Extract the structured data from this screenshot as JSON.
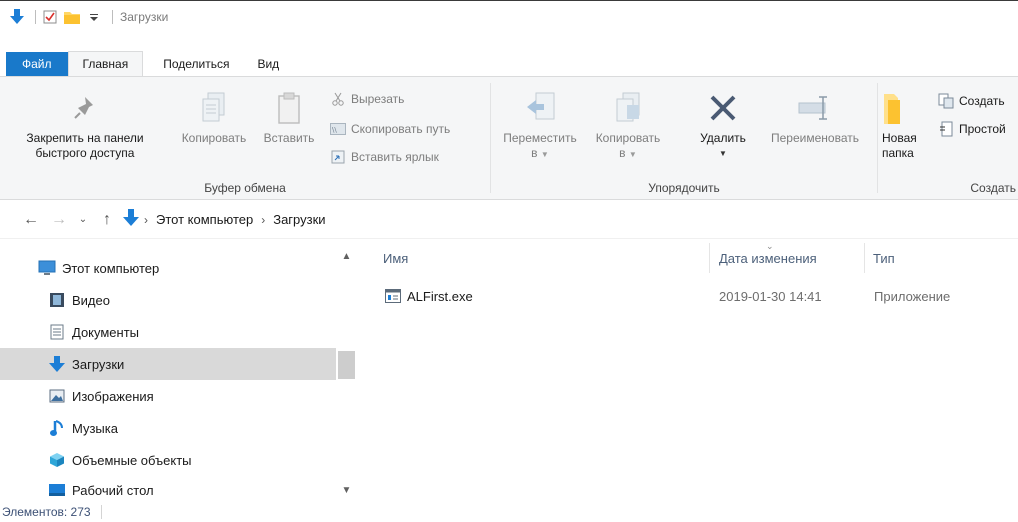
{
  "window": {
    "title": "Загрузки"
  },
  "quick_access": {
    "icons": [
      "download-arrow-icon",
      "properties-icon",
      "new-folder-icon",
      "customize-dropdown-icon"
    ]
  },
  "ribbon_tabs": [
    "Файл",
    "Главная",
    "Поделиться",
    "Вид"
  ],
  "ribbon": {
    "clipboard": {
      "group_label": "Буфер обмена",
      "pin_line1": "Закрепить на панели",
      "pin_line2": "быстрого доступа",
      "copy": "Копировать",
      "paste": "Вставить",
      "cut": "Вырезать",
      "copy_path": "Скопировать путь",
      "paste_shortcut": "Вставить ярлык"
    },
    "organize": {
      "group_label": "Упорядочить",
      "move_line1": "Переместить",
      "move_line2": "в",
      "copy_line1": "Копировать",
      "copy_line2": "в",
      "delete": "Удалить",
      "rename": "Переименовать"
    },
    "create": {
      "group_label": "Создать",
      "new_folder_line1": "Новая",
      "new_folder_line2": "папка",
      "new_item": "Создать",
      "easy_access": "Простой"
    }
  },
  "address": {
    "breadcrumbs": [
      "Этот компьютер",
      "Загрузки"
    ]
  },
  "nav_pane": {
    "items": [
      {
        "label": "Этот компьютер",
        "icon": "computer-icon"
      },
      {
        "label": "Видео",
        "icon": "video-icon"
      },
      {
        "label": "Документы",
        "icon": "documents-icon"
      },
      {
        "label": "Загрузки",
        "icon": "downloads-icon",
        "selected": true
      },
      {
        "label": "Изображения",
        "icon": "pictures-icon"
      },
      {
        "label": "Музыка",
        "icon": "music-icon"
      },
      {
        "label": "Объемные объекты",
        "icon": "3d-objects-icon"
      },
      {
        "label": "Рабочий стол",
        "icon": "desktop-icon"
      }
    ]
  },
  "file_list": {
    "columns": {
      "name": "Имя",
      "date": "Дата изменения",
      "type": "Тип"
    },
    "rows": [
      {
        "name": "ALFirst.exe",
        "date": "2019-01-30 14:41",
        "type": "Приложение"
      }
    ]
  },
  "status": {
    "items_count": "Элементов: 273"
  },
  "colors": {
    "accent": "#1979ca",
    "selection": "#d9d9d9",
    "ribbon_bg": "#f5f6f7",
    "header_text": "#4c607a"
  }
}
